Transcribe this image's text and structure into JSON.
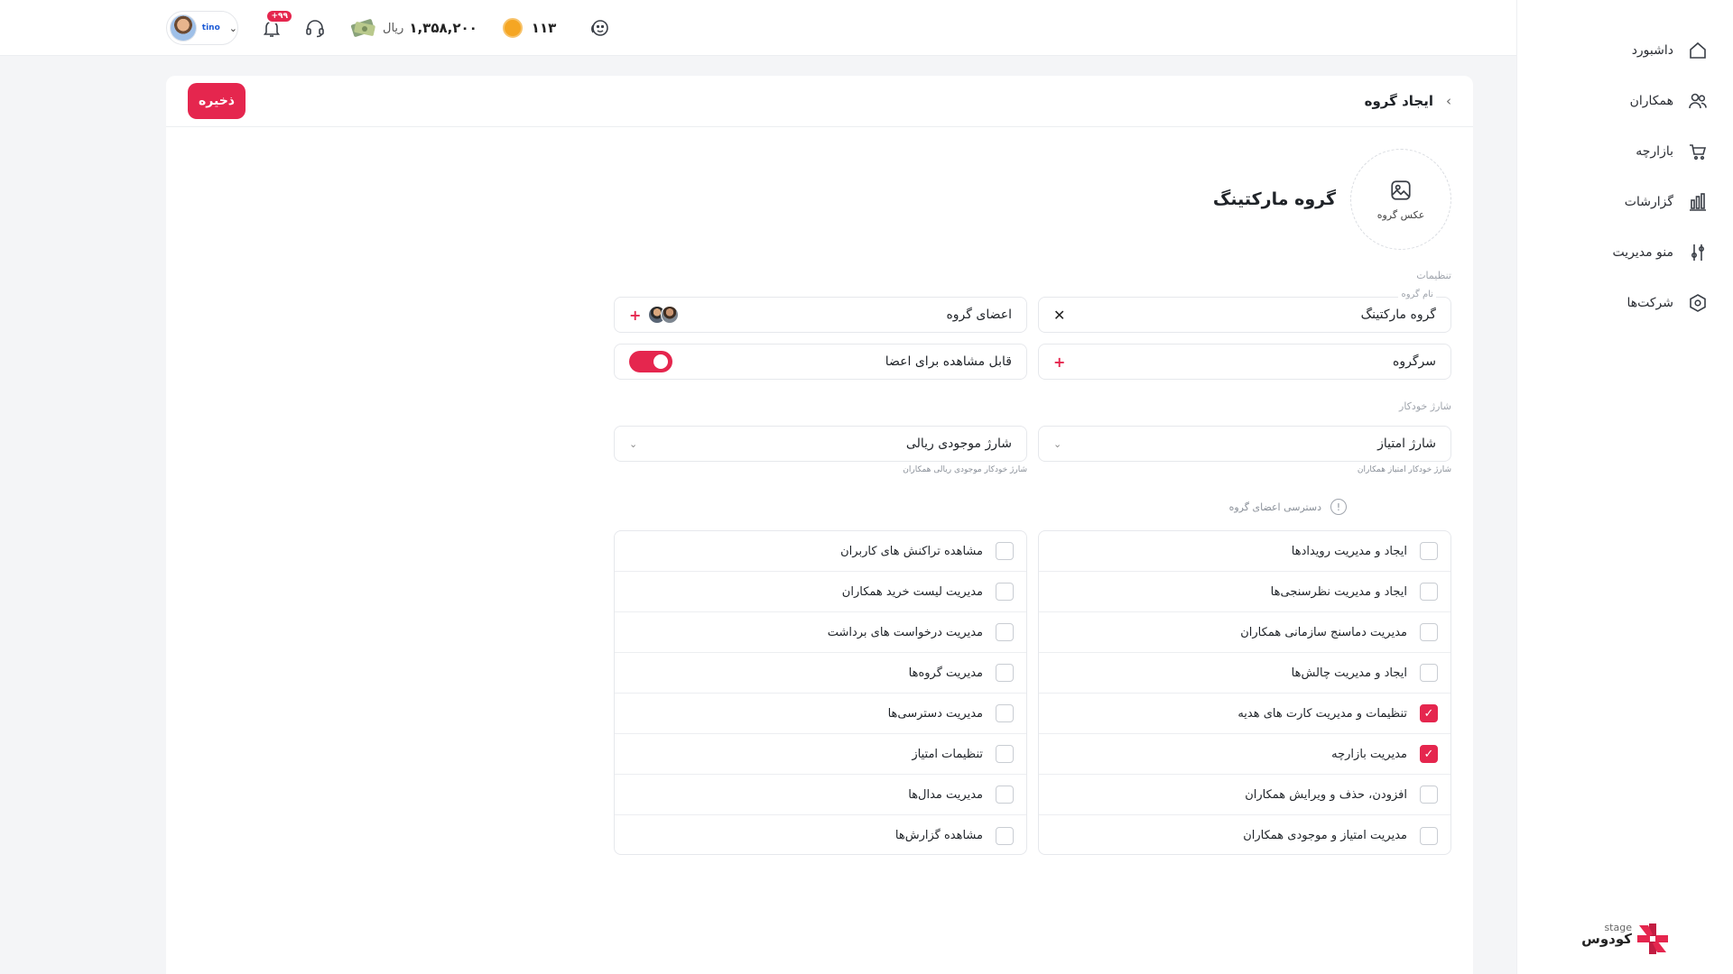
{
  "colors": {
    "accent": "#e5264e",
    "text": "#1f2328",
    "muted": "#a0a5ad",
    "border": "#e6e8ec"
  },
  "sidebar": {
    "items": [
      {
        "label": "داشبورد",
        "icon": "home-icon"
      },
      {
        "label": "همکاران",
        "icon": "users-icon"
      },
      {
        "label": "بازارچه",
        "icon": "cart-icon"
      },
      {
        "label": "گزارشات",
        "icon": "chart-icon"
      },
      {
        "label": "منو مدیریت",
        "icon": "sliders-icon"
      },
      {
        "label": "شرکت‌ها",
        "icon": "hexagon-icon"
      }
    ],
    "brand": {
      "name": "کودوس",
      "tag": "stage"
    }
  },
  "topbar": {
    "avatar_tag": "tino",
    "notifications_badge": "+۹۹",
    "wallet_amount": "۱,۳۵۸,۲۰۰",
    "wallet_unit": "ریال",
    "points": "۱۱۳"
  },
  "header": {
    "title": "ایجاد گروه",
    "save_label": "ذخیره"
  },
  "group": {
    "photo_label": "عکس گروه",
    "title": "گروه مارکتینگ"
  },
  "settings": {
    "section_label": "تنظیمات",
    "name_label": "نام گروه",
    "name_value": "گروه مارکتینگ",
    "members_label": "اعضای گروه",
    "leader_label": "سرگروه",
    "visible_label": "قابل مشاهده برای اعضا",
    "visible_on": true
  },
  "auto_charge": {
    "section_label": "شارژ خودکار",
    "points_label": "شارژ امتیاز",
    "points_helper": "شارژ خودکار امتیاز همکاران",
    "rial_label": "شارژ موجودی ریالی",
    "rial_helper": "شارژ خودکار موجودی ریالی همکاران"
  },
  "permissions": {
    "title": "دسترسی اعضای گروه",
    "right_column": [
      {
        "label": "ایجاد و مدیریت رویدادها",
        "checked": false
      },
      {
        "label": "ایجاد و مدیریت نظرسنجی‌ها",
        "checked": false
      },
      {
        "label": "مدیریت دماسنج سازمانی همکاران",
        "checked": false
      },
      {
        "label": "ایجاد و مدیریت چالش‌ها",
        "checked": false
      },
      {
        "label": "تنظیمات و مدیریت کارت های هدیه",
        "checked": true
      },
      {
        "label": "مدیریت بازارچه",
        "checked": true
      },
      {
        "label": "افزودن، حذف و ویرایش همکاران",
        "checked": false
      },
      {
        "label": "مدیریت امتیاز و موجودی همکاران",
        "checked": false
      }
    ],
    "left_column": [
      {
        "label": "مشاهده تراکنش های کاربران",
        "checked": false
      },
      {
        "label": "مدیریت لیست خرید همکاران",
        "checked": false
      },
      {
        "label": "مدیریت درخواست های برداشت",
        "checked": false
      },
      {
        "label": "مدیریت گروه‌ها",
        "checked": false
      },
      {
        "label": "مدیریت دسترسی‌ها",
        "checked": false
      },
      {
        "label": "تنظیمات امتیاز",
        "checked": false
      },
      {
        "label": "مدیریت مدال‌ها",
        "checked": false
      },
      {
        "label": "مشاهده گزارش‌ها",
        "checked": false
      }
    ]
  }
}
